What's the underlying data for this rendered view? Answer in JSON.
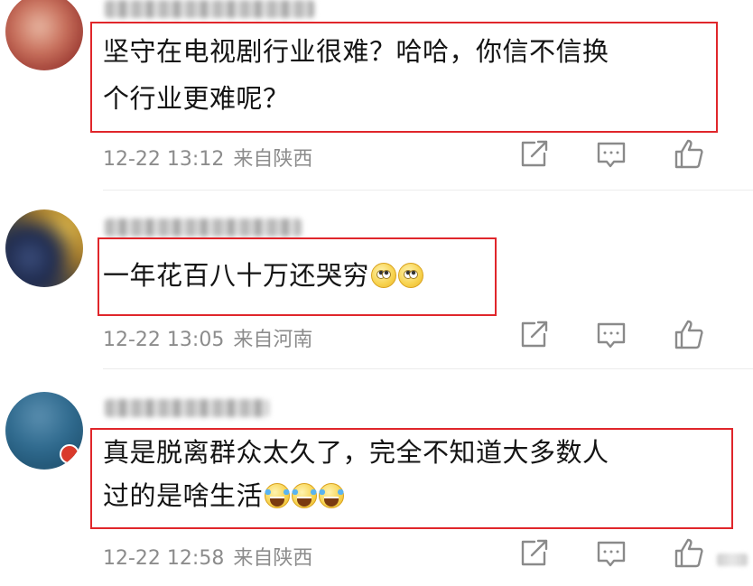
{
  "comments": [
    {
      "text_lines": [
        "坚守在电视剧行业很难？哈哈，你信不信换",
        "个行业更难呢？"
      ],
      "time": "12-22 13:12",
      "location": "来自陕西"
    },
    {
      "text_lines": [
        "一年花百八十万还哭穷"
      ],
      "emojis": [
        "rolling-eyes-emoji",
        "rolling-eyes-emoji"
      ],
      "time": "12-22 13:05",
      "location": "来自河南"
    },
    {
      "text_lines": [
        "真是脱离群众太久了，完全不知道大多数人",
        "过的是啥生活"
      ],
      "emojis": [
        "laugh-cry-emoji",
        "laugh-cry-emoji",
        "laugh-cry-emoji"
      ],
      "time": "12-22 12:58",
      "location": "来自陕西"
    }
  ],
  "actions": [
    "share-icon",
    "reply-icon",
    "like-icon"
  ],
  "colors": {
    "highlight_border": "#e0262b",
    "text": "#141414",
    "meta": "#8c8c8c",
    "icon": "#8a8a8a"
  }
}
